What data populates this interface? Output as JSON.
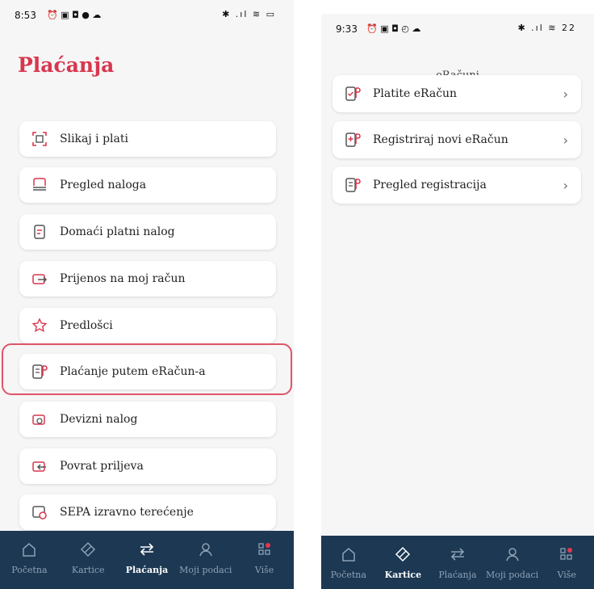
{
  "left_screen": {
    "status": {
      "time": "8:53",
      "icons": "⏰ ▣ ◘ ● ☁",
      "right_icons": "✱ .ıl ≋ ▭"
    },
    "title": "Plaćanja",
    "items": [
      {
        "label": "Slikaj i plati",
        "icon": "qr-scan-icon"
      },
      {
        "label": "Pregled naloga",
        "icon": "document-tray-icon"
      },
      {
        "label": "Domaći platni nalog",
        "icon": "document-icon"
      },
      {
        "label": "Prijenos na moj račun",
        "icon": "wallet-transfer-icon"
      },
      {
        "label": "Predlošci",
        "icon": "star-icon"
      },
      {
        "label": "Plaćanje putem eRačun-a",
        "icon": "e-invoice-icon"
      },
      {
        "label": "Devizni nalog",
        "icon": "wallet-foreign-icon"
      },
      {
        "label": "Povrat priljeva",
        "icon": "wallet-return-icon"
      },
      {
        "label": "SEPA izravno terećenje",
        "icon": "sepa-icon"
      }
    ],
    "tabs": [
      {
        "label": "Početna",
        "icon": "home-icon"
      },
      {
        "label": "Kartice",
        "icon": "card-icon"
      },
      {
        "label": "Plaćanja",
        "icon": "transfer-icon"
      },
      {
        "label": "Moji podaci",
        "icon": "user-icon"
      },
      {
        "label": "Više",
        "icon": "grid-icon"
      }
    ],
    "active_tab": "Plaćanja"
  },
  "right_screen": {
    "status": {
      "time": "9:33",
      "icons": "⏰ ▣ ◘ ◴ ☁",
      "right_icons": "✱ .ıl ≋ 22"
    },
    "subtitle": "eRačuni",
    "items": [
      {
        "label": "Platite eRačun",
        "icon": "pay-invoice-icon",
        "chevron": "›"
      },
      {
        "label": "Registriraj novi eRačun",
        "icon": "add-invoice-icon",
        "chevron": "›"
      },
      {
        "label": "Pregled registracija",
        "icon": "list-invoice-icon",
        "chevron": "›"
      }
    ],
    "tabs": [
      {
        "label": "Početna",
        "icon": "home-icon"
      },
      {
        "label": "Kartice",
        "icon": "card-icon"
      },
      {
        "label": "Plaćanja",
        "icon": "transfer-icon"
      },
      {
        "label": "Moji podaci",
        "icon": "user-icon"
      },
      {
        "label": "Više",
        "icon": "grid-icon"
      }
    ],
    "active_tab": "Kartice"
  },
  "colors": {
    "accent": "#d9364f",
    "tabbar": "#1c3853",
    "highlight": "#e05468"
  }
}
